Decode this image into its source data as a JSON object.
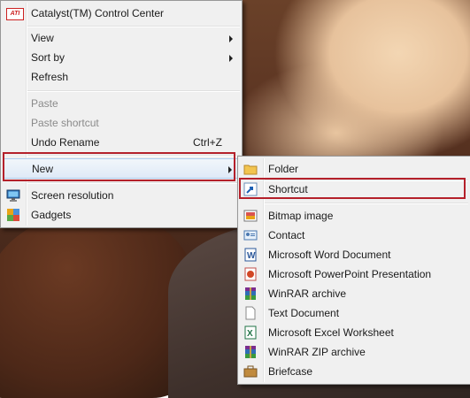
{
  "context_menu": {
    "items": {
      "catalyst": "Catalyst(TM) Control Center",
      "view": "View",
      "sort_by": "Sort by",
      "refresh": "Refresh",
      "paste": "Paste",
      "paste_shortcut": "Paste shortcut",
      "undo_rename": "Undo Rename",
      "undo_rename_shortcut": "Ctrl+Z",
      "new": "New",
      "screen_resolution": "Screen resolution",
      "gadgets": "Gadgets"
    },
    "catalyst_icon_text": "ATI"
  },
  "new_submenu": {
    "items": [
      "Folder",
      "Shortcut",
      "Bitmap image",
      "Contact",
      "Microsoft Word Document",
      "Microsoft PowerPoint Presentation",
      "WinRAR archive",
      "Text Document",
      "Microsoft Excel Worksheet",
      "WinRAR ZIP archive",
      "Briefcase"
    ],
    "icons": [
      "folder-icon",
      "shortcut-icon",
      "bitmap-icon",
      "contact-icon",
      "word-icon",
      "powerpoint-icon",
      "winrar-icon",
      "text-document-icon",
      "excel-icon",
      "winrar-zip-icon",
      "briefcase-icon"
    ]
  },
  "colors": {
    "highlight_box": "#b4202a",
    "menu_bg": "#f0f0f0",
    "hover_border": "#aecbee"
  }
}
